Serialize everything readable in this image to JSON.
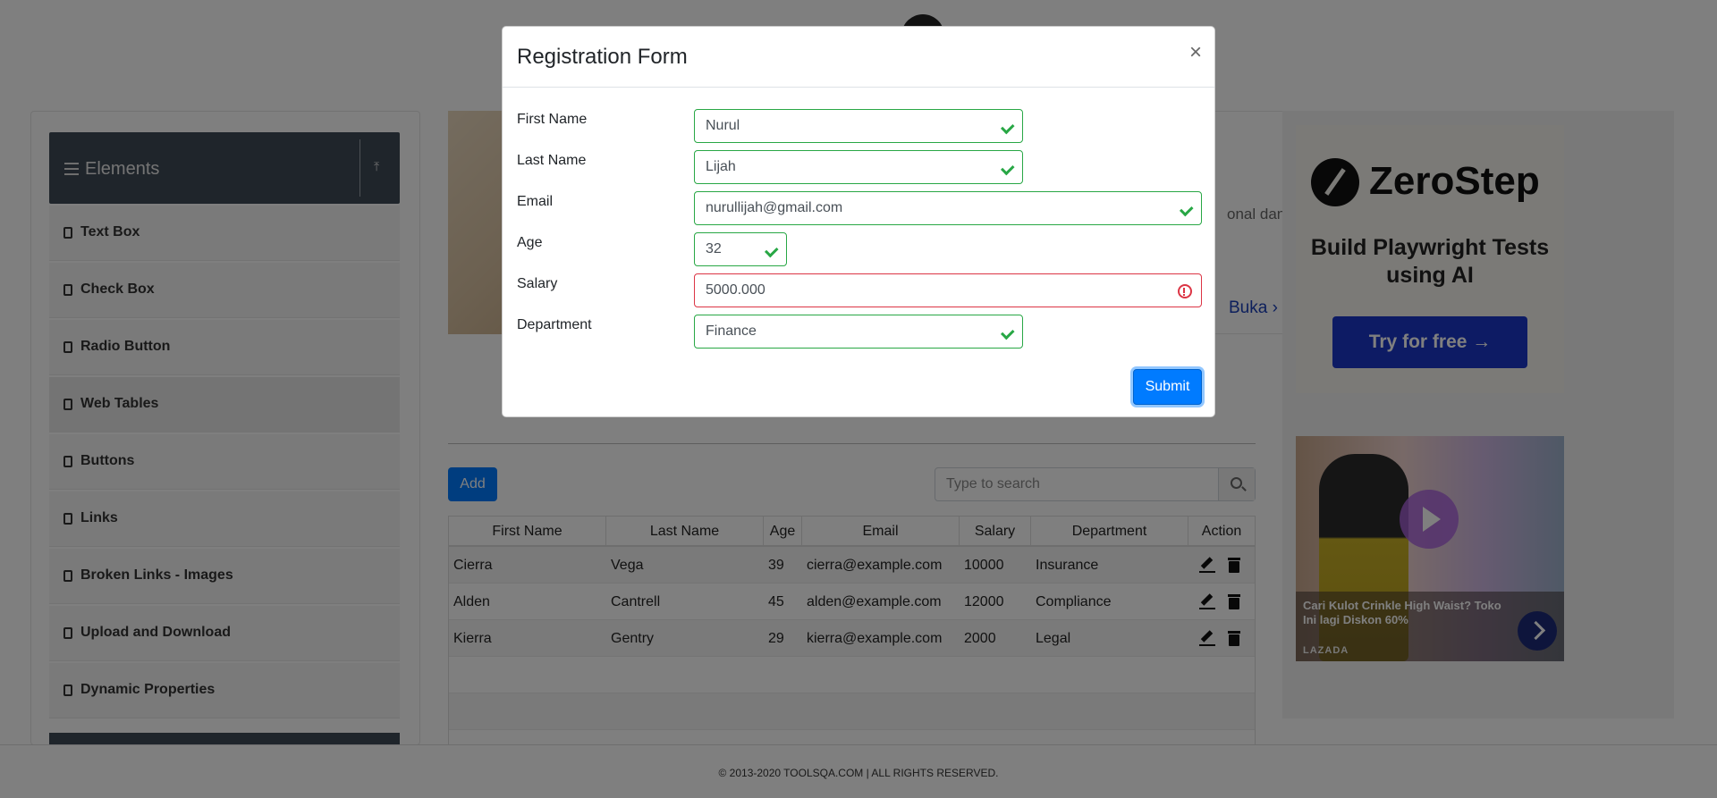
{
  "sidebar": {
    "group_title": "Elements",
    "items": [
      {
        "label": "Text Box"
      },
      {
        "label": "Check Box"
      },
      {
        "label": "Radio Button"
      },
      {
        "label": "Web Tables"
      },
      {
        "label": "Buttons"
      },
      {
        "label": "Links"
      },
      {
        "label": "Broken Links - Images"
      },
      {
        "label": "Upload and Download"
      },
      {
        "label": "Dynamic Properties"
      }
    ],
    "active_item": "Web Tables"
  },
  "banner": {
    "snippet": "onal dan",
    "link_label": "Buka"
  },
  "web_table": {
    "add_label": "Add",
    "search_placeholder": "Type to search",
    "columns": [
      "First Name",
      "Last Name",
      "Age",
      "Email",
      "Salary",
      "Department",
      "Action"
    ],
    "rows": [
      {
        "first": "Cierra",
        "last": "Vega",
        "age": "39",
        "email": "cierra@example.com",
        "salary": "10000",
        "department": "Insurance"
      },
      {
        "first": "Alden",
        "last": "Cantrell",
        "age": "45",
        "email": "alden@example.com",
        "salary": "12000",
        "department": "Compliance"
      },
      {
        "first": "Kierra",
        "last": "Gentry",
        "age": "29",
        "email": "kierra@example.com",
        "salary": "2000",
        "department": "Legal"
      }
    ]
  },
  "ads": {
    "zerostep": {
      "brand": "ZeroStep",
      "headline": "Build Playwright Tests using AI",
      "cta": "Try for free →"
    },
    "lazada": {
      "caption": "Cari Kulot Crinkle High Waist? Toko Ini lagi Diskon 60%",
      "brand": "LAZADA"
    }
  },
  "footer": {
    "text": "© 2013-2020 TOOLSQA.COM | ALL RIGHTS RESERVED."
  },
  "modal": {
    "title": "Registration Form",
    "close_label": "×",
    "fields": {
      "first_name": {
        "label": "First Name",
        "value": "Nurul",
        "status": "valid"
      },
      "last_name": {
        "label": "Last Name",
        "value": "Lijah",
        "status": "valid"
      },
      "email": {
        "label": "Email",
        "value": "nurullijah@gmail.com",
        "status": "valid"
      },
      "age": {
        "label": "Age",
        "value": "32",
        "status": "valid"
      },
      "salary": {
        "label": "Salary",
        "value": "5000.000",
        "status": "invalid"
      },
      "department": {
        "label": "Department",
        "value": "Finance",
        "status": "valid"
      }
    },
    "submit_label": "Submit"
  },
  "colors": {
    "primary": "#007bff",
    "valid": "#28a745",
    "invalid": "#dc3545",
    "sidebar_header": "#3f4b57"
  }
}
